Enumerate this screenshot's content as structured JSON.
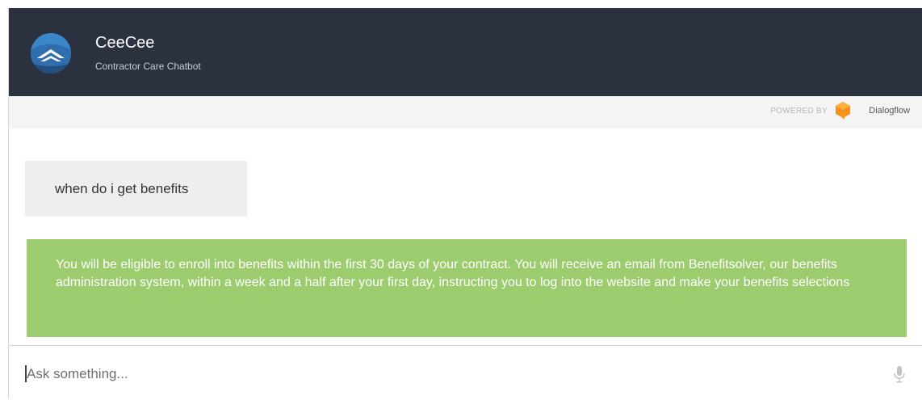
{
  "header": {
    "bot_name": "CeeCee",
    "bot_subtitle": "Contractor Care Chatbot",
    "background_color": "#2c3140",
    "avatar_icon": "mountain-logo-icon"
  },
  "powered_by": {
    "label": "POWERED BY",
    "brand": "Dialogflow",
    "brand_icon": "dialogflow-logo-icon",
    "brand_color": "#f7921e"
  },
  "messages": [
    {
      "sender": "user",
      "text": "when do i get benefits",
      "bubble_color": "#eeeeee"
    },
    {
      "sender": "bot",
      "text": "You will be eligible to enroll into benefits within the first 30 days of your contract. You will receive an email from Benefitsolver, our benefits administration system, within a week and a half after your first day, instructing you to log into the website and make your benefits selections",
      "bubble_color": "#9ccc6e"
    }
  ],
  "input": {
    "placeholder": "Ask something...",
    "value": "",
    "mic_icon": "microphone-icon"
  }
}
